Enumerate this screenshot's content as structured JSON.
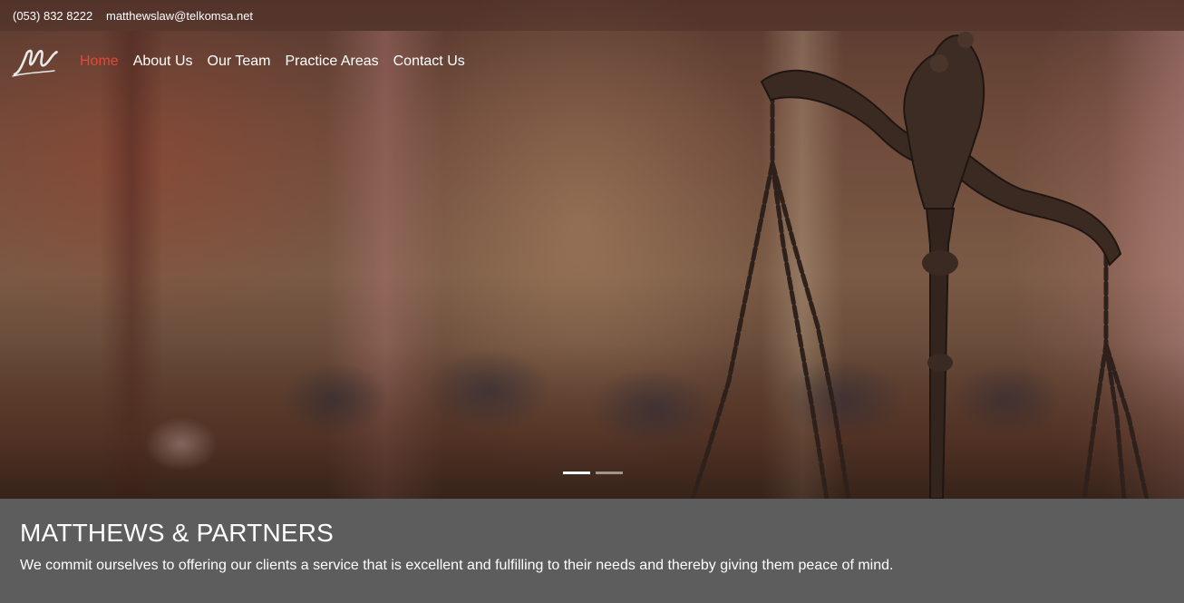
{
  "topbar": {
    "phone": "(053) 832 8222",
    "email": "matthewslaw@telkomsa.net"
  },
  "logo": {
    "glyph": "M"
  },
  "nav": {
    "items": [
      {
        "label": "Home",
        "active": true
      },
      {
        "label": "About Us"
      },
      {
        "label": "Our Team"
      },
      {
        "label": "Practice Areas"
      },
      {
        "label": "Contact Us"
      }
    ]
  },
  "carousel": {
    "slides": 2,
    "active_index": 0
  },
  "caption": {
    "title": "MATTHEWS & PARTNERS",
    "tagline": "We commit ourselves to offering our clients a service that is excellent and fulfilling to their needs and thereby giving them peace of mind."
  },
  "colors": {
    "accent": "#e2493a",
    "caption_bg": "#5d5d5d"
  }
}
